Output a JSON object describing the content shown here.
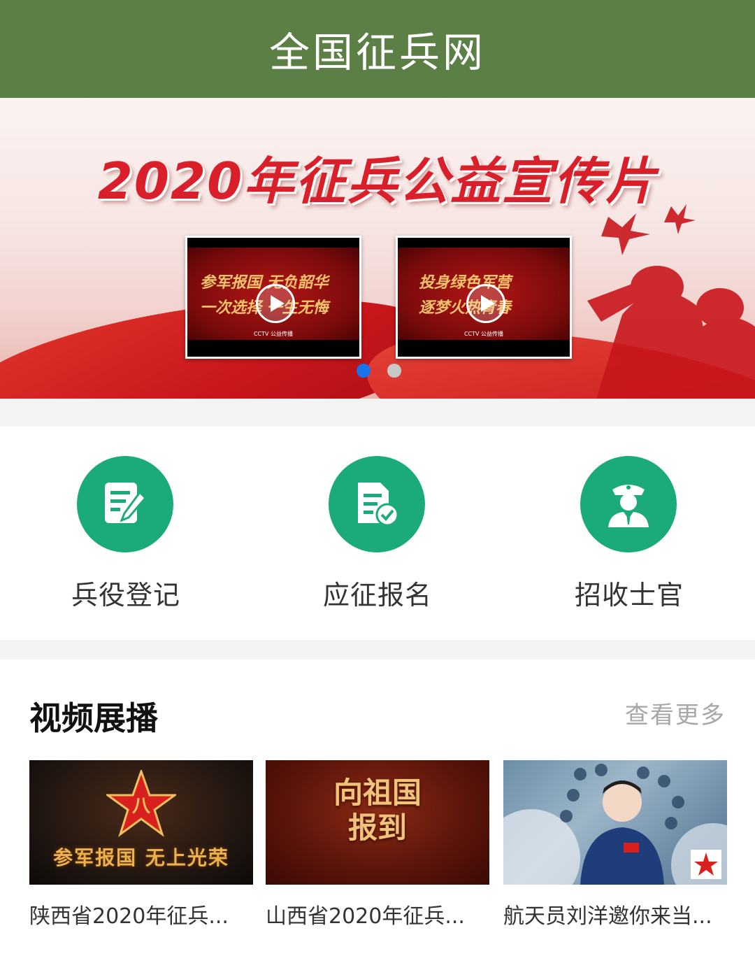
{
  "header": {
    "title": "全国征兵网"
  },
  "banner": {
    "title": "2020年征兵公益宣传片",
    "videos": [
      {
        "text_line1": "参军报国 无负韶华",
        "text_line2": "一次选择 一生无悔",
        "footer": "CCTV 公益传播"
      },
      {
        "text_line1": "投身绿色军营",
        "text_line2": "逐梦火热青春",
        "footer": "CCTV 公益传播"
      }
    ],
    "active_slide": 1,
    "slide_count": 2,
    "colors": {
      "active_dot": "#1a73e8",
      "inactive_dot": "#c8c8c8"
    }
  },
  "quick_links": [
    {
      "label": "兵役登记",
      "icon": "edit-form-icon"
    },
    {
      "label": "应征报名",
      "icon": "document-check-icon"
    },
    {
      "label": "招收士官",
      "icon": "officer-icon"
    }
  ],
  "video_section": {
    "title": "视频展播",
    "more_label": "查看更多",
    "items": [
      {
        "title": "陕西省2020年征兵...",
        "image_text": "参军报国 无上光荣"
      },
      {
        "title": "山西省2020年征兵...",
        "image_text": "向祖国报到"
      },
      {
        "title": "航天员刘洋邀你来当...",
        "image_text": ""
      }
    ]
  },
  "colors": {
    "header_bg": "#5b7f44",
    "accent_green": "#1bab7b"
  }
}
